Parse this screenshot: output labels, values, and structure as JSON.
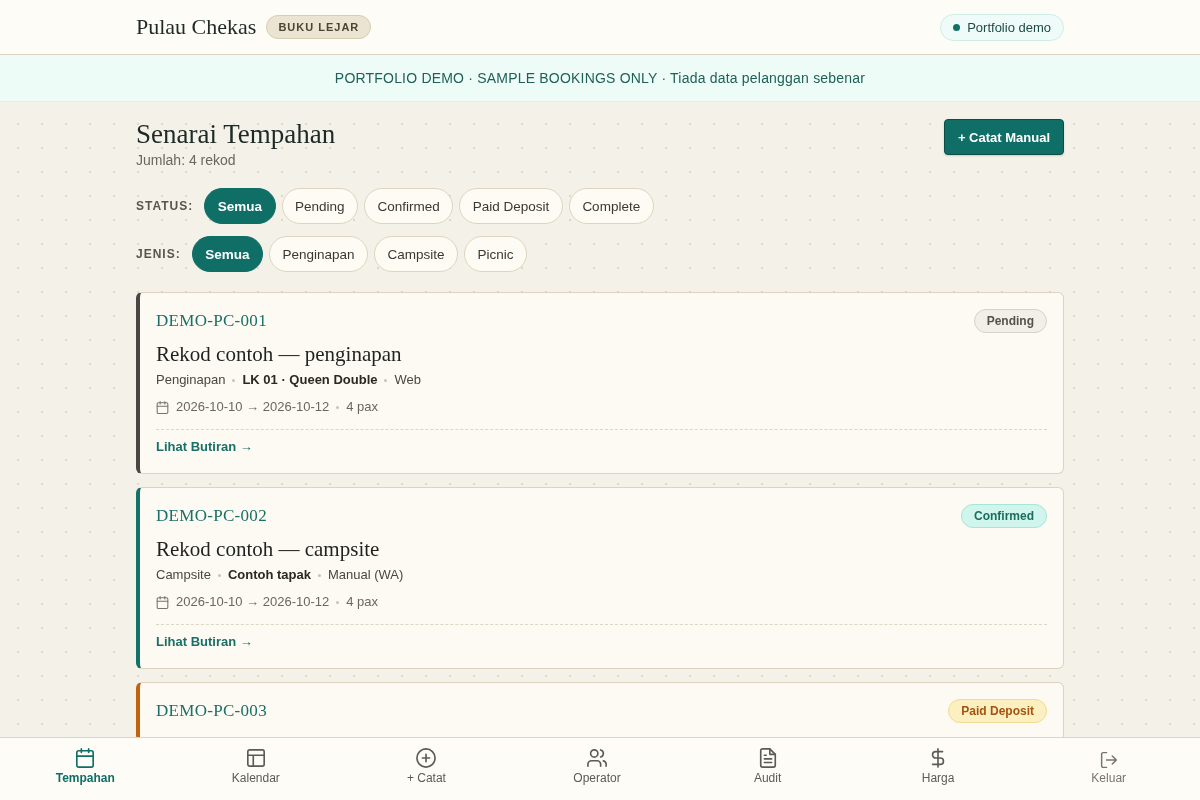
{
  "header": {
    "brand": "Pulau Chekas",
    "brand_tag": "BUKU LEJAR",
    "status_chip": "Portfolio demo"
  },
  "banner": "PORTFOLIO DEMO · SAMPLE BOOKINGS ONLY · Tiada data pelanggan sebenar",
  "page": {
    "title": "Senarai Tempahan",
    "subtitle": "Jumlah: 4 rekod",
    "action_button": "+ Catat Manual"
  },
  "filters": [
    {
      "label": "STATUS:",
      "options": [
        {
          "label": "Semua",
          "selected": true
        },
        {
          "label": "Pending",
          "selected": false
        },
        {
          "label": "Confirmed",
          "selected": false
        },
        {
          "label": "Paid Deposit",
          "selected": false
        },
        {
          "label": "Complete",
          "selected": false
        }
      ]
    },
    {
      "label": "JENIS:",
      "options": [
        {
          "label": "Semua",
          "selected": true
        },
        {
          "label": "Penginapan",
          "selected": false
        },
        {
          "label": "Campsite",
          "selected": false
        },
        {
          "label": "Picnic",
          "selected": false
        }
      ]
    }
  ],
  "bookings": [
    {
      "id": "DEMO-PC-001",
      "status": "Pending",
      "kind": "pending",
      "title": "Rekod contoh — penginapan",
      "type": "Penginapan",
      "unit": "LK 01 · Queen Double",
      "source": "Web",
      "dates": "2026-10-10 → 2026-10-12",
      "pax": "4 pax",
      "link": "Lihat Butiran →"
    },
    {
      "id": "DEMO-PC-002",
      "status": "Confirmed",
      "kind": "confirmed",
      "title": "Rekod contoh — campsite",
      "type": "Campsite",
      "unit": "Contoh tapak",
      "source": "Manual (WA)",
      "dates": "2026-10-10 → 2026-10-12",
      "pax": "4 pax",
      "link": "Lihat Butiran →"
    },
    {
      "id": "DEMO-PC-003",
      "status": "Paid Deposit",
      "kind": "deposit"
    }
  ],
  "nav": [
    {
      "label": "Tempahan",
      "kind": "tab",
      "selected": true
    },
    {
      "label": "Kalendar",
      "kind": "tab",
      "selected": false
    },
    {
      "label": "+ Catat",
      "kind": "tab",
      "selected": false
    },
    {
      "label": "Operator",
      "kind": "tab",
      "selected": false
    },
    {
      "label": "Audit",
      "kind": "tab",
      "selected": false
    },
    {
      "label": "Harga",
      "kind": "tab",
      "selected": false
    },
    {
      "label": "Keluar",
      "kind": "action",
      "selected": false
    }
  ]
}
